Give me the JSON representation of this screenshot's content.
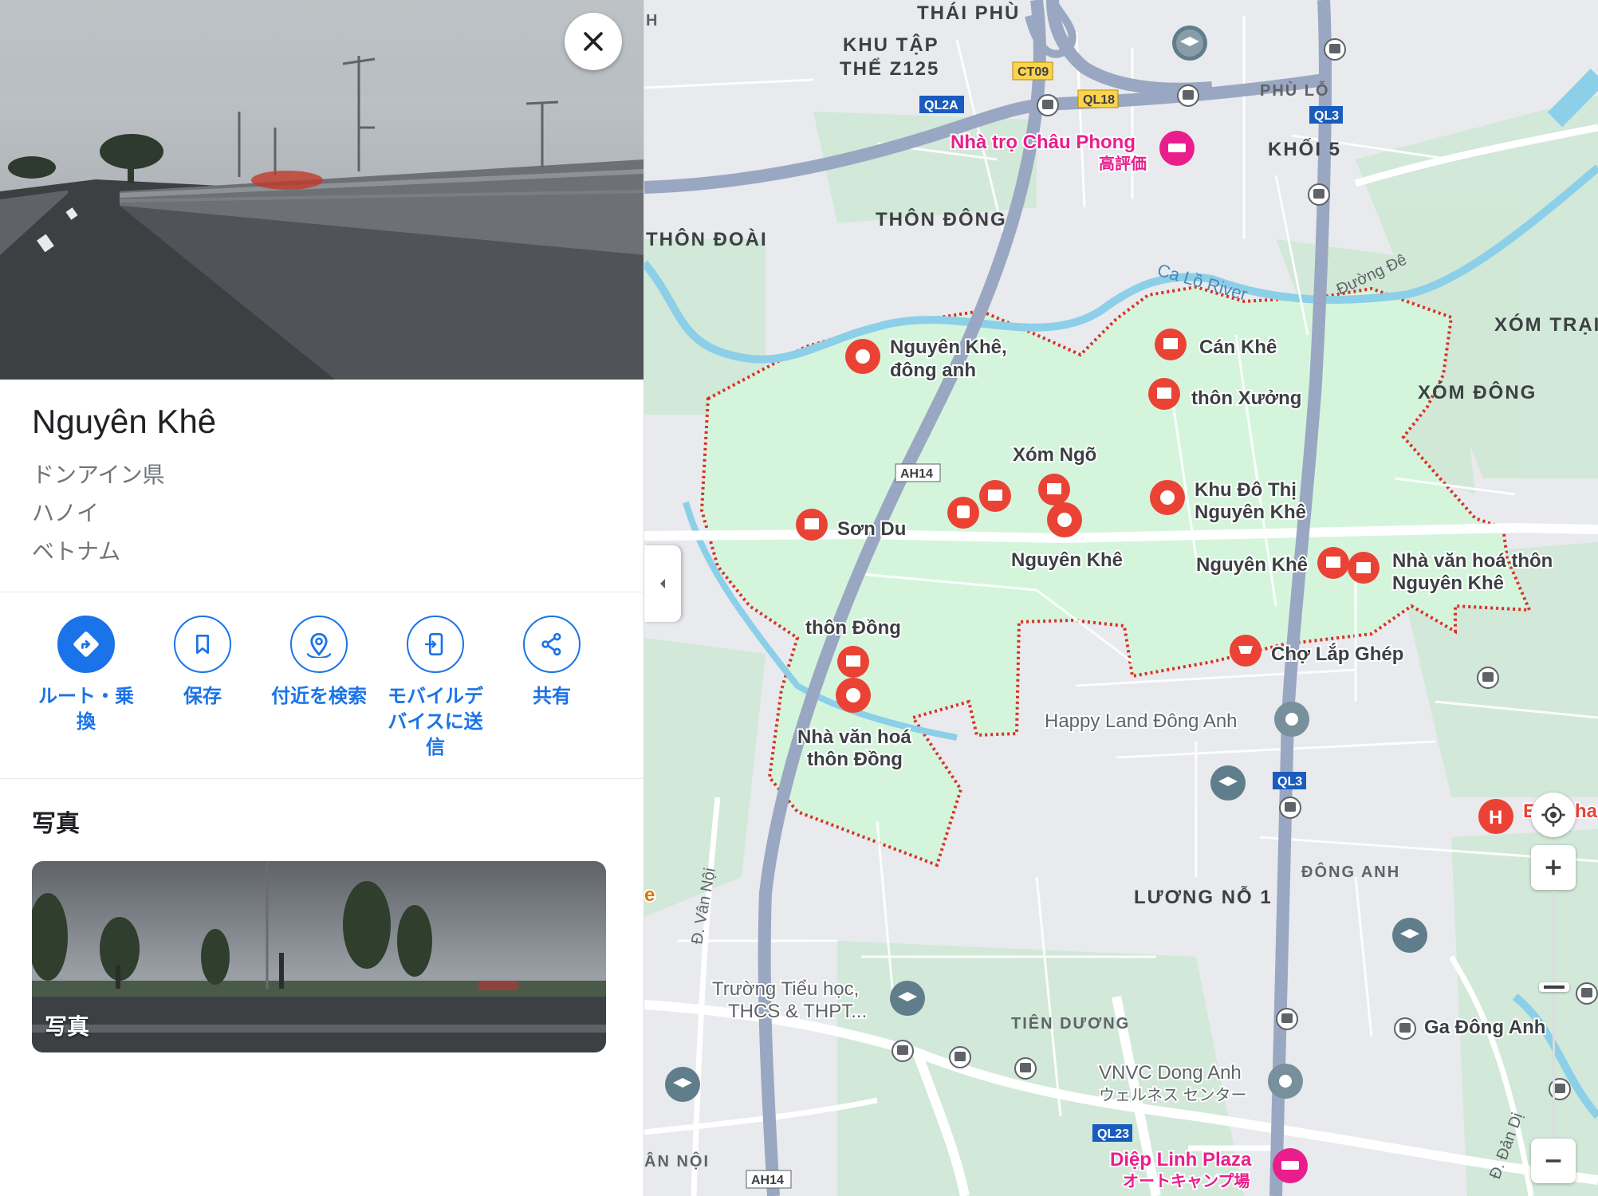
{
  "place": {
    "name": "Nguyên Khê",
    "address_lines": [
      "ドンアイン県",
      "ハノイ",
      "ベトナム"
    ]
  },
  "actions": [
    {
      "icon": "directions-icon",
      "label_line1": "ルート・乗",
      "label_line2": "換",
      "label_line3": ""
    },
    {
      "icon": "bookmark-icon",
      "label_line1": "保存",
      "label_line2": "",
      "label_line3": ""
    },
    {
      "icon": "nearby-search-icon",
      "label_line1": "付近を検索",
      "label_line2": "",
      "label_line3": ""
    },
    {
      "icon": "send-to-device-icon",
      "label_line1": "モバイルデ",
      "label_line2": "バイスに送",
      "label_line3": "信"
    },
    {
      "icon": "share-icon",
      "label_line1": "共有",
      "label_line2": "",
      "label_line3": ""
    }
  ],
  "photos": {
    "heading": "写真",
    "card_label": "写真"
  },
  "map": {
    "area_labels": {
      "thai_phu": "THÁI PHÙ",
      "khu_tap_1": "KHU TẬP",
      "khu_tap_2": "THỂ Z125",
      "phu_lo": "PHÙ LỖ",
      "khoi5": "KHỐI 5",
      "thon_dong_upper": "THÔN ĐÔNG",
      "thon_doai": "THÔN ĐOÀI",
      "xom_trai": "XÓM TRẠI",
      "xom_dong": "XÓM ĐÔNG",
      "dong_anh": "ĐÔNG ANH",
      "luong_no": "LƯƠNG NỖ 1",
      "tien_duong": "TIÊN DƯƠNG",
      "an_noi": "ÂN NỘI",
      "h_edge": "H"
    },
    "road_shields": [
      "CT09",
      "QL18",
      "QL2A",
      "QL3",
      "AH14",
      "QL3",
      "QL23",
      "AH14"
    ],
    "places": {
      "nha_tro": "Nhà trọ Châu Phong",
      "nha_tro_sub": "高評価",
      "nguyen_khe_dong_anh_1": "Nguyên Khê,",
      "nguyen_khe_dong_anh_2": "đông anh",
      "can_khe": "Cán Khê",
      "thon_xuong": "thôn Xưởng",
      "xom_ngo": "Xóm Ngõ",
      "khu_do_thi_1": "Khu Đô Thị",
      "khu_do_thi_2": "Nguyên Khê",
      "son_du": "Sơn Du",
      "nguyen_khe_center": "Nguyên Khê",
      "nguyen_khe_right": "Nguyên Khê",
      "nha_van_hoa_1": "Nhà văn hoá thôn",
      "nha_van_hoa_2": "Nguyên Khê",
      "thon_dong": "thôn Đồng",
      "nvh_thon_dong_1": "Nhà văn hoá",
      "nvh_thon_dong_2": "thôn Đồng",
      "cho_lap_ghep": "Chợ Lắp Ghép",
      "happy_land": "Happy Land Đông Anh",
      "truong_1": "Trường Tiểu học,",
      "truong_2": "THCS & THPT...",
      "ga_dong_anh": "Ga Đông Anh",
      "vnvc_1": "VNVC Dong Anh",
      "vnvc_2": "ウェルネス センター",
      "diep_linh_1": "Diệp Linh Plaza",
      "diep_linh_2": "オートキャンプ場",
      "edge_e": "E",
      "edge_ha": "ha",
      "edge_e2": "e"
    },
    "roads": {
      "river": "Ca Lồ River",
      "duong_de": "Đường Đê",
      "van_noi": "Đ. Vân Nội",
      "dan_di": "Đ. Đản Dị"
    },
    "colors": {
      "boundary": "#d93025",
      "highlight": "#d4f5dc",
      "pin": "#ea4335",
      "water": "#8ccfe8",
      "shield": "#1a5cbd",
      "shield_yellow": "#fcd34d"
    }
  }
}
